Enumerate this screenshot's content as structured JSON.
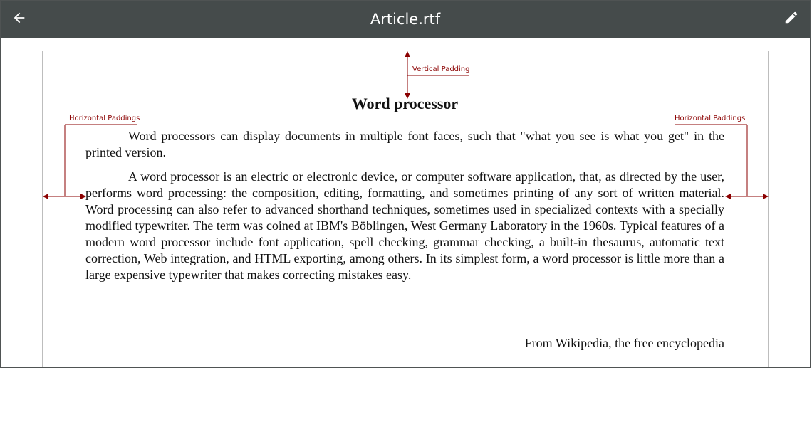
{
  "titlebar": {
    "title": "Article.rtf",
    "back_icon": "back-arrow-icon",
    "edit_icon": "pencil-icon"
  },
  "document": {
    "heading": "Word processor",
    "paragraphs": [
      "Word processors can display documents in multiple font faces, such that \"what you see is what you get\" in the printed version.",
      "A word processor is an electric or electronic device, or computer software application, that, as directed by the user, performs word processing: the composition, editing, formatting, and sometimes printing of any sort of written material. Word processing can also refer to advanced shorthand techniques, sometimes used in specialized contexts with a specially modified typewriter. The term was coined at IBM's Böblingen, West Germany Laboratory in the 1960s. Typical features of a modern word processor include font application, spell checking, grammar checking, a built-in thesaurus, automatic text correction, Web integration, and HTML exporting, among others. In its simplest form, a word processor is little more than a large expensive typewriter that makes correcting mistakes easy."
    ],
    "source": "From Wikipedia, the free encyclopedia"
  },
  "annotations": {
    "vertical_padding_label": "Vertical Padding",
    "horizontal_paddings_left_label": "Horizontal Paddings",
    "horizontal_paddings_right_label": "Horizontal Paddings"
  },
  "colors": {
    "titlebar_bg": "#454b4b",
    "annotation": "#8b0000",
    "page_border": "#bdbdbd"
  }
}
